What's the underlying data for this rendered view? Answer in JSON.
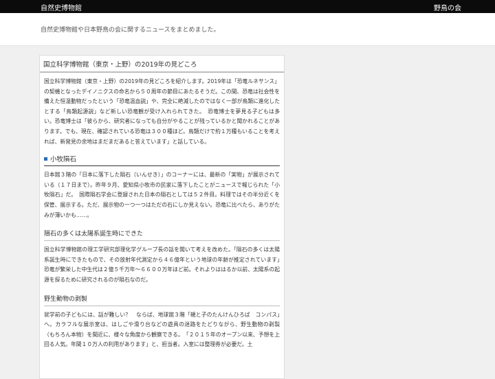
{
  "topbar": {
    "site_name": "自然史博物館",
    "right_link": "野鳥の会"
  },
  "header": {
    "description": "自然史博物館や日本野鳥の会に関するニュースをまとめました。"
  },
  "article": {
    "title": "国立科学博物館（東京・上野）の2019年の見どころ",
    "intro": "国立科学博物館（東京・上野）の2019年の見どころを紹介します。2019年は「恐竜ルネサンス」の契機となったデイノニクスの命名から５０周年の節目にあたるそうだ。この間、恐竜は社会性を備えた恒温動物だったという「恐竜温血説」や、完全に絶滅したのではなく一部が鳥類に進化したとする「鳥類起源説」など新しい恐竜観が受け入れられてきた。　恐竜博士を夢見る子どもは多い。恐竜博士は「彼らから、研究者になっても自分がやることが残っているかと聞かれることがあります。でも、現在、確認されている恐竜は３００種ほど。鳥類だけで約１万種もいることを考えれば、新発見の余地はまだまだあると答えています」と話している。",
    "section1_heading": "小牧隕石",
    "section1_text": "日本館３階の「日本に落下した隕石（いんせき）」のコーナーには、最新の「実物」が展示されている（１７日まで）。昨年９月、愛知県小牧市の民家に落下したことがニュースで報じられた「小牧隕石」だ。　国際隕石学会に登録された日本の隕石としては５２件目。料理ではその半分近くを保管、展示する。ただ、展示物の一つ一つはただの石にしか見えない。恐竜に比べたら、ありがたみが薄いかも……。",
    "section2_heading": "隕石の多くは太陽系誕生時にできた",
    "section2_text": "国立科学博物館の理工学研究部理化学グループ長の話を聞いて考えを改めた。「隕石の多くは太陽系誕生時にできたもので、その放射年代測定から４６億年という地球の年齢が推定されています」　恐竜が繁栄した中生代は２億５千万年～６６００万年ほど前。それよりははるか以前、太陽系の起源を探るために研究されるのが隕石なのだ。",
    "section3_heading": "野生動物の剥製",
    "section3_text": "就学前の子どもには、話が難しい？　ならば、地球館３階「親と子のたんけんひろば　コンパス」へ。カラフルな展示室は、はしごや滑り台などの遊具の迷路をたどりながら、野生動物の剥製（もちろん本物）を間近に、様々な角度から観察できる。　「２０１５年のオープン以来、予想を上回る人気。年間１０万人の利用があります」と、担当者。入室には整理券が必要だ。土"
  }
}
